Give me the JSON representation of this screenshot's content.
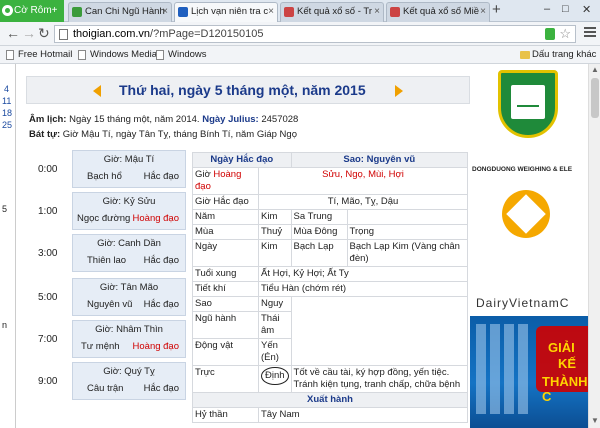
{
  "browser": {
    "app_button": "Cờ Rôm+",
    "tabs": [
      {
        "label": "Can Chi Ngũ Hành",
        "fav_color": "#3b9b3b"
      },
      {
        "label": "Lịch vạn niên tra c",
        "fav_color": "#1f5fbf"
      },
      {
        "label": "Kết quả xổ số - Tr",
        "fav_color": "#c44"
      },
      {
        "label": "Kết quả xổ số Miề",
        "fav_color": "#c44"
      }
    ],
    "url_domain": "thoigian.com.vn",
    "url_path": "/?mPage=D120150105",
    "bookmarks": [
      "Free Hotmail",
      "Windows Media",
      "Windows"
    ],
    "bookmark_folder": "Dấu trang khác"
  },
  "left_strip": [
    "4",
    "11",
    "18",
    "25",
    "5",
    "n"
  ],
  "page": {
    "title": "Thứ hai, ngày 5 tháng một, năm 2015",
    "am_lich_label": "Âm lịch:",
    "am_lich_value": "Ngày 15 tháng một, năm 2014.",
    "julius_label": "Ngày Julius:",
    "julius_value": "2457028",
    "bat_tu_label": "Bát tự:",
    "bat_tu_value": "Giờ Mậu Tí, ngày Tân Tỵ, tháng Bính Tí, năm Giáp Ngọ"
  },
  "hours": [
    {
      "time": "0:00",
      "gio": "Giờ: Mậu Tí",
      "name": "Bạch hổ",
      "status": "Hắc đạo",
      "status_red": false
    },
    {
      "time": "1:00",
      "gio": "Giờ: Kỷ Sửu",
      "name": "Ngọc đường",
      "status": "Hoàng đạo",
      "status_red": true
    },
    {
      "time": "3:00",
      "gio": "Giờ: Canh Dần",
      "name": "Thiên lao",
      "status": "Hắc đạo",
      "status_red": false
    },
    {
      "time": "5:00",
      "gio": "Giờ: Tân Mão",
      "name": "Nguyên vũ",
      "status": "Hắc đạo",
      "status_red": false
    },
    {
      "time": "7:00",
      "gio": "Giờ: Nhâm Thìn",
      "name": "Tư mệnh",
      "status": "Hoàng đạo",
      "status_red": true
    },
    {
      "time": "9:00",
      "gio": "Giờ: Quý Tỵ",
      "name": "Câu trận",
      "status": "Hắc đạo",
      "status_red": false
    }
  ],
  "day_table": {
    "header_left": "Ngày Hắc đạo",
    "header_right": "Sao: Nguyên vũ",
    "gio_hoang_dao_label": "Giờ",
    "gio_hoang_dao_red": "Hoàng đạo",
    "gio_hoang_dao_value": "Sửu, Ngọ, Mùi, Hợi",
    "gio_hac_dao_label": "Giờ Hắc đạo",
    "gio_hac_dao_value": "Tí, Mão, Tỵ, Dậu",
    "rows": [
      {
        "label": "Năm",
        "c1": "Kim",
        "c2": "Sa Trung",
        "c3": ""
      },
      {
        "label": "Mùa",
        "c1": "Thuỷ",
        "c2": "Mùa Đông",
        "c3": "Trọng"
      },
      {
        "label": "Ngày",
        "c1": "Kim",
        "c2": "Bạch Lạp",
        "c3": "Bạch Lạp Kim (Vàng chân đèn)"
      }
    ],
    "tuoi_xung_label": "Tuổi xung",
    "tuoi_xung_value": "Ất Hợi, Kỷ Hợi; Ất Ty",
    "tiet_khi_label": "Tiết khí",
    "tiet_khi_value": "Tiểu Hàn (chớm rét)",
    "sao_label": "Sao",
    "sao_value": "Nguy",
    "ngu_hanh_label": "Ngũ hành",
    "ngu_hanh_value": "Thái âm",
    "dong_vat_label": "Động vật",
    "dong_vat_value": "Yến (Én)",
    "truc_label": "Trực",
    "truc_value": "Định",
    "truc_note": "Tốt về cầu tài, ký hợp đồng, yến tiệc. Tránh kiện tụng, tranh chấp, chữa bệnh",
    "xuat_hanh": "Xuất hành",
    "hy_than_label": "Hỷ thần",
    "hy_than_value": "Tây Nam"
  },
  "ads": {
    "ad1_text": "DONGDUONG WEIGHING & ELE",
    "ad2_text": "DairyVietnamC",
    "ad3_t1": "GIẢI",
    "ad3_t2": "KẾ",
    "ad3_t3": "THÀNH C"
  }
}
